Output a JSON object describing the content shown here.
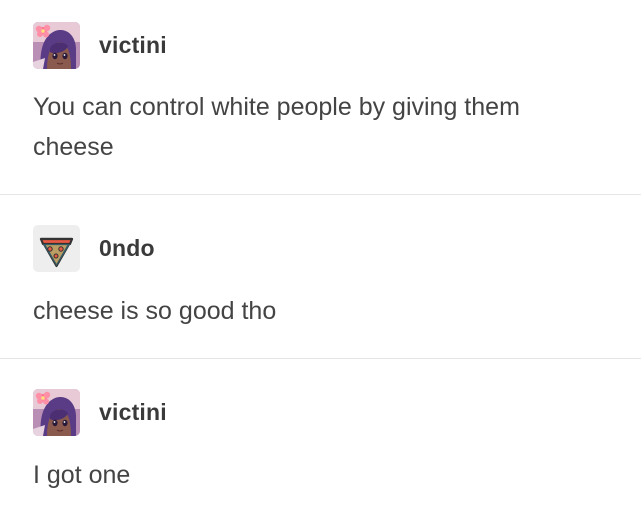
{
  "posts": [
    {
      "username": "victini",
      "avatar_icon": "anime-girl-avatar-icon",
      "text": "You can control white people by giving them cheese"
    },
    {
      "username": "0ndo",
      "avatar_icon": "pizza-slice-avatar-icon",
      "text": "cheese is so good tho"
    },
    {
      "username": "victini",
      "avatar_icon": "anime-girl-avatar-icon",
      "text": "I got one"
    }
  ],
  "colors": {
    "divider": "#e6e6e6",
    "text": "#444444",
    "username": "#3a3a3a",
    "background": "#ffffff"
  }
}
